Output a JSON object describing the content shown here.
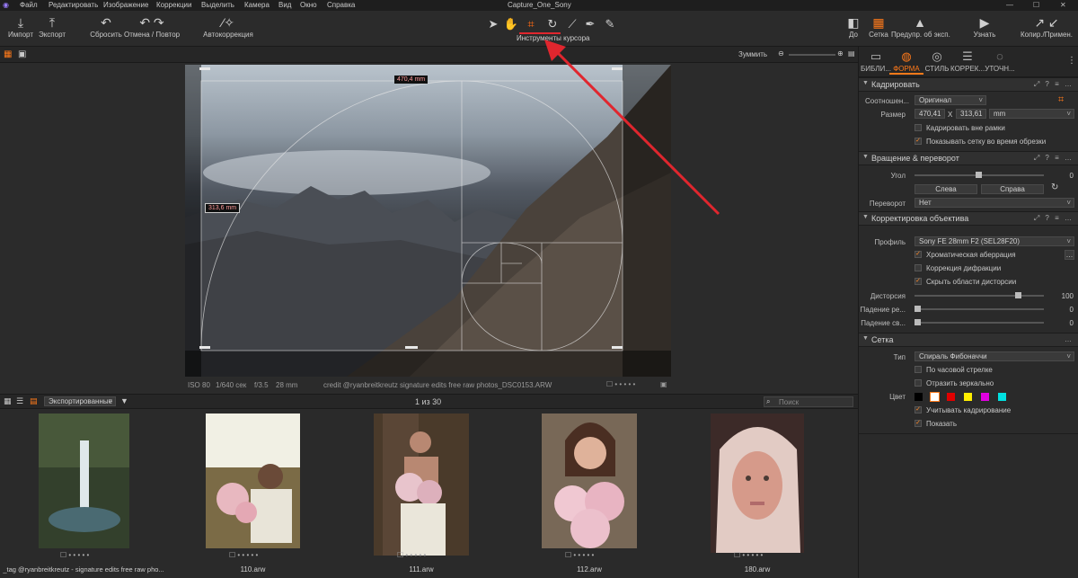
{
  "app": {
    "title": "Capture_One_Sony",
    "logo": "capture-one-logo"
  },
  "menu": [
    "Файл",
    "Редактировать",
    "Изображение",
    "Коррекции",
    "Выделить",
    "Камера",
    "Вид",
    "Окно",
    "Справка"
  ],
  "toolbar": {
    "import": "Импорт",
    "export": "Экспорт",
    "reset": "Сбросить",
    "undo_redo": "Отмена / Повтор",
    "auto": "Автокоррекция",
    "cursor_tools": "Инструменты курсора",
    "before": "До",
    "grid": "Сетка",
    "exposure_warning": "Предупр. об эксп.",
    "learn": "Узнать",
    "copy_apply": "Копир./Примен."
  },
  "viewer": {
    "zoom_label": "Зуммить",
    "width_label": "470,4 mm",
    "height_label": "313,6 mm"
  },
  "info": {
    "iso": "ISO 80",
    "shutter": "1/640 сек",
    "aperture": "f/3.5",
    "focal": "28 mm",
    "caption": "credit @ryanbreitkreutz signature edits free raw photos_DSC0153.ARW"
  },
  "film": {
    "album": "Экспортированные",
    "count": "1 из 30",
    "search_placeholder": "Поиск"
  },
  "thumbs": [
    {
      "name": "_tag @ryanbreitkreutz - signature edits free raw pho...",
      "rating": "☐ • • • • •"
    },
    {
      "name": "110.arw",
      "rating": "☐ • • • • •"
    },
    {
      "name": "111.arw",
      "rating": "☐ • • • • •"
    },
    {
      "name": "112.arw",
      "rating": "☐ • • • • •"
    },
    {
      "name": "180.arw",
      "rating": "☐ • • • • •"
    }
  ],
  "tabs": [
    "БИБЛИ...",
    "ФОРМА",
    "СТИЛЬ",
    "КОРРЕК...",
    "УТОЧН..."
  ],
  "crop": {
    "title": "Кадрировать",
    "ratio_label": "Соотношен...",
    "ratio_value": "Оригинал",
    "size_label": "Размер",
    "width": "470,41",
    "x": "X",
    "height": "313,61",
    "unit": "mm",
    "outside": "Кадрировать вне рамки",
    "show_grid": "Показывать сетку во время обрезки"
  },
  "rotate": {
    "title": "Вращение & переворот",
    "angle_label": "Угол",
    "angle_value": "0",
    "left": "Слева",
    "right": "Справа",
    "flip_label": "Переворот",
    "flip_value": "Нет"
  },
  "lens": {
    "title": "Корректировка объектива",
    "profile_label": "Профиль",
    "profile_value": "Sony FE 28mm F2 (SEL28F20)",
    "chrom": "Хроматическая аберрация",
    "diffraction": "Коррекция дифракции",
    "hide": "Скрыть области дисторсии",
    "distortion_label": "Дисторсия",
    "distortion_value": "100",
    "falloff1_label": "Падение ре...",
    "falloff1_value": "0",
    "falloff2_label": "Падение св...",
    "falloff2_value": "0"
  },
  "grid": {
    "title": "Сетка",
    "type_label": "Тип",
    "type_value": "Спираль Фибоначчи",
    "clockwise": "По часовой стрелке",
    "mirror": "Отразить зеркально",
    "color_label": "Цвет",
    "colors": [
      "#000000",
      "#ffffff",
      "#e00000",
      "#ffee00",
      "#e000e0",
      "#00e0e0"
    ],
    "consider_crop": "Учитывать кадрирование",
    "show": "Показать"
  },
  "accent": "#ff6a13",
  "arrow_color": "#e0262e"
}
